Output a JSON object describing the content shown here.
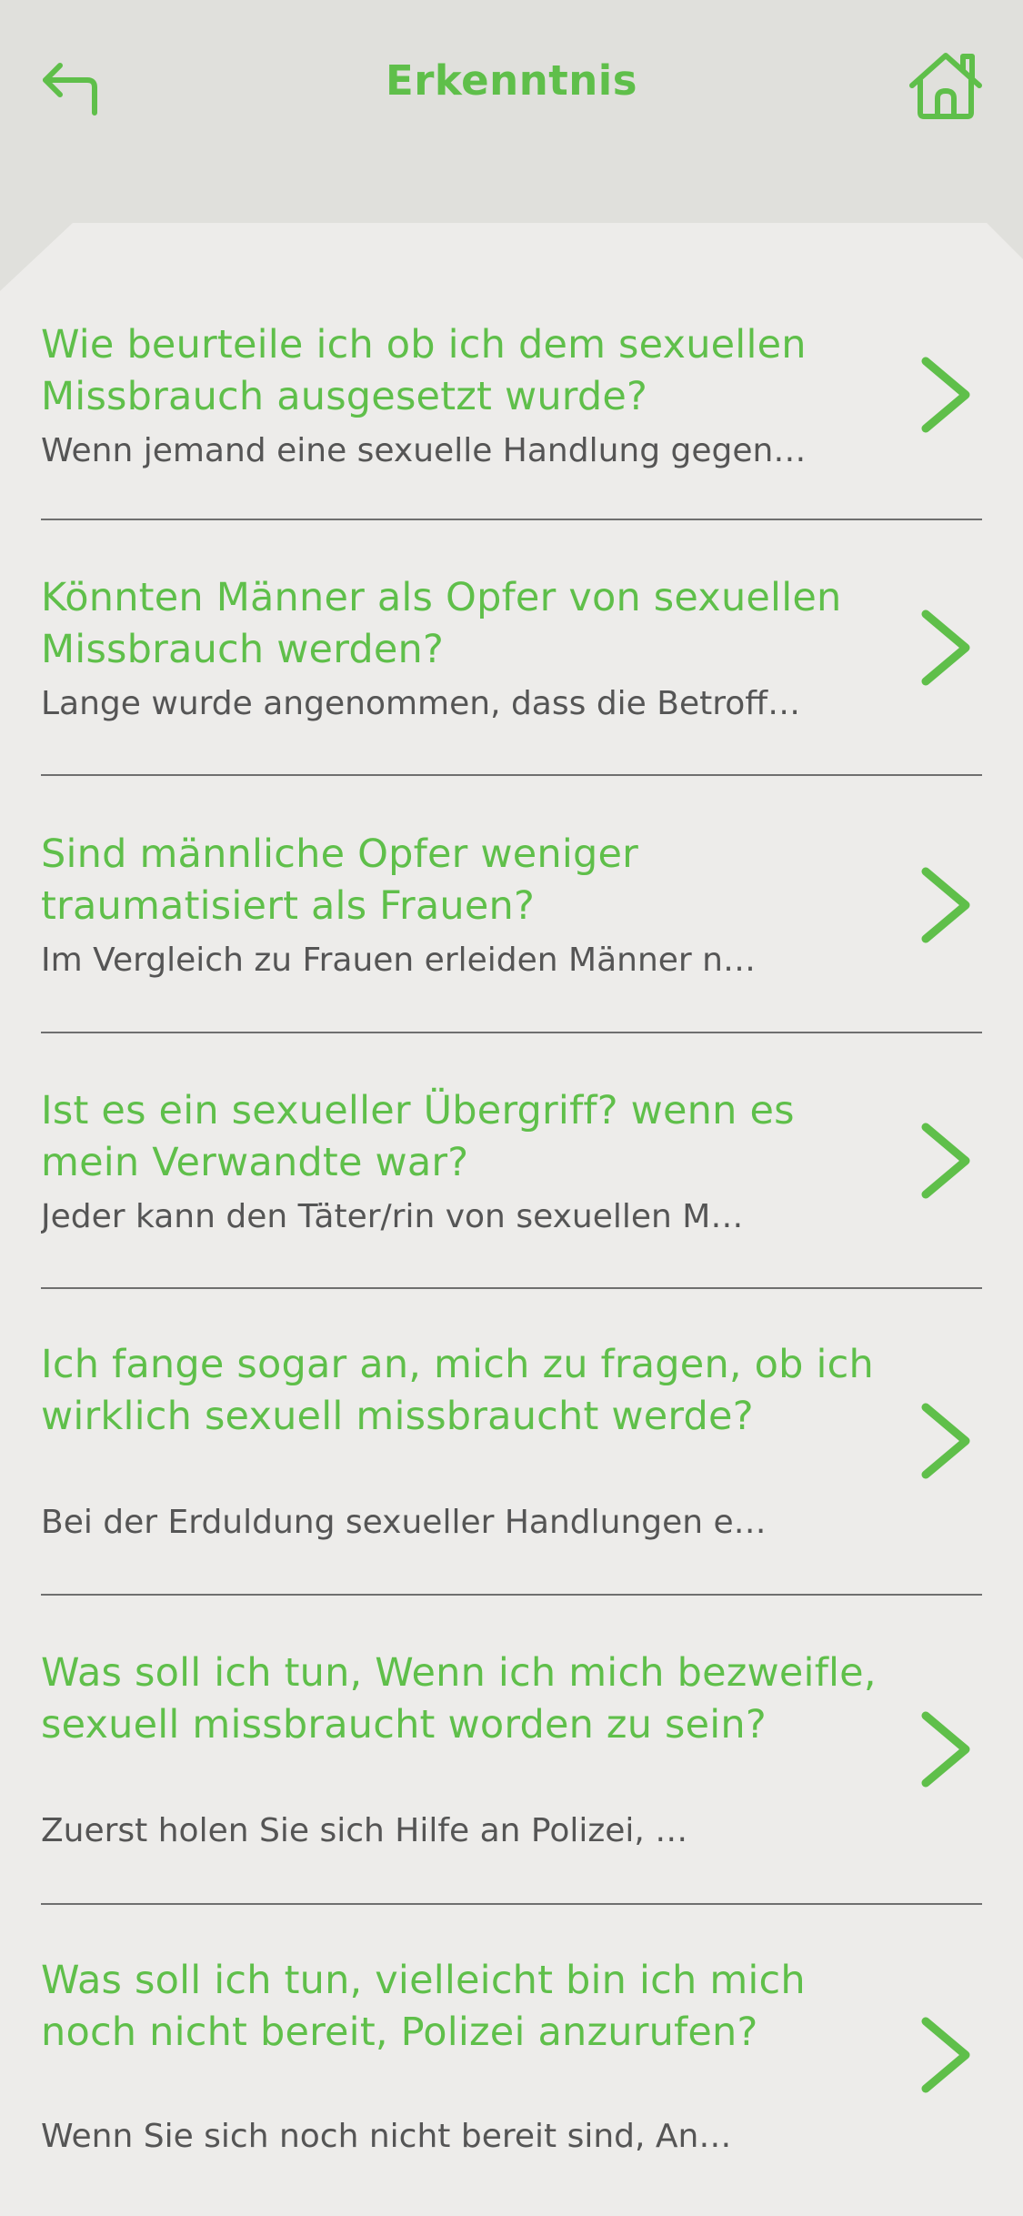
{
  "header": {
    "title": "Erkenntnis"
  },
  "colors": {
    "accent": "#5fbf4a",
    "card_background": "#edecea",
    "page_background": "#e0e0dc",
    "answer_text": "#555555",
    "divider": "#6f6f6f"
  },
  "icons": {
    "back": "back-arrow-icon",
    "home": "home-icon",
    "chevron": "chevron-right-icon"
  },
  "items": [
    {
      "question": "Wie beurteile ich ob ich dem sexuellen Missbrauch ausgesetzt wurde?",
      "answer": "Wenn jemand eine sexuelle Handlung gegen…"
    },
    {
      "question": "Könnten Männer als Opfer von sexuellen Missbrauch werden?",
      "answer": "Lange wurde angenommen, dass die Betroff…"
    },
    {
      "question": "Sind männliche Opfer weniger traumatisiert als Frauen?",
      "answer": "Im Vergleich zu Frauen erleiden Männer n…"
    },
    {
      "question": "Ist es ein sexueller Übergriff? wenn es mein Verwandte war?",
      "answer": "Jeder kann den Täter/rin von sexuellen M…"
    },
    {
      "question": "Ich fange sogar an, mich zu fragen, ob ich wirklich sexuell missbraucht werde?",
      "answer": "Bei der Erduldung sexueller Handlungen e…"
    },
    {
      "question": "Was soll ich tun, Wenn ich mich bezweifle, sexuell missbraucht worden zu sein?",
      "answer": "Zuerst holen Sie sich Hilfe an Polizei, …"
    },
    {
      "question": "Was soll ich tun, vielleicht bin ich mich noch nicht bereit, Polizei anzurufen?",
      "answer": "Wenn Sie sich noch nicht bereit sind, An…"
    }
  ]
}
